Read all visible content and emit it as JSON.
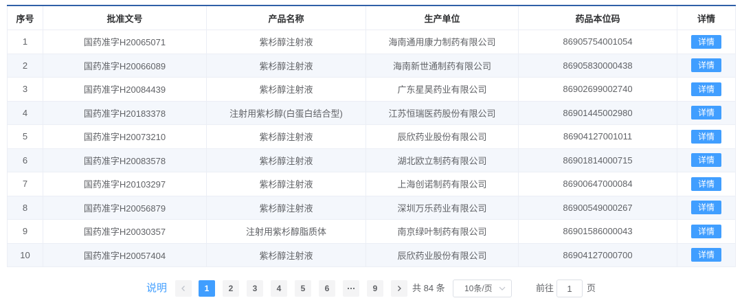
{
  "theme": {
    "accent": "#409eff",
    "header_border": "#2f5fa7",
    "stripe": "#f4f7fc",
    "text": "#606266",
    "heading": "#303133",
    "pager_bg": "#f4f4f5",
    "border": "#ebeef5",
    "muted": "#c0c4cc"
  },
  "table": {
    "columns": {
      "index": "序号",
      "approval_no": "批准文号",
      "product": "产品名称",
      "manufacturer": "生产单位",
      "code": "药品本位码",
      "action": "详情"
    },
    "rows": [
      {
        "index": "1",
        "approval_no": "国药准字H20065071",
        "product": "紫杉醇注射液",
        "manufacturer": "海南通用康力制药有限公司",
        "code": "86905754001054",
        "action": "详情"
      },
      {
        "index": "2",
        "approval_no": "国药准字H20066089",
        "product": "紫杉醇注射液",
        "manufacturer": "海南新世通制药有限公司",
        "code": "86905830000438",
        "action": "详情"
      },
      {
        "index": "3",
        "approval_no": "国药准字H20084439",
        "product": "紫杉醇注射液",
        "manufacturer": "广东星昊药业有限公司",
        "code": "86902699002740",
        "action": "详情"
      },
      {
        "index": "4",
        "approval_no": "国药准字H20183378",
        "product": "注射用紫杉醇(白蛋白结合型)",
        "manufacturer": "江苏恒瑞医药股份有限公司",
        "code": "86901445002980",
        "action": "详情"
      },
      {
        "index": "5",
        "approval_no": "国药准字H20073210",
        "product": "紫杉醇注射液",
        "manufacturer": "辰欣药业股份有限公司",
        "code": "86904127001011",
        "action": "详情"
      },
      {
        "index": "6",
        "approval_no": "国药准字H20083578",
        "product": "紫杉醇注射液",
        "manufacturer": "湖北欧立制药有限公司",
        "code": "86901814000715",
        "action": "详情"
      },
      {
        "index": "7",
        "approval_no": "国药准字H20103297",
        "product": "紫杉醇注射液",
        "manufacturer": "上海创诺制药有限公司",
        "code": "86900647000084",
        "action": "详情"
      },
      {
        "index": "8",
        "approval_no": "国药准字H20056879",
        "product": "紫杉醇注射液",
        "manufacturer": "深圳万乐药业有限公司",
        "code": "86900549000267",
        "action": "详情"
      },
      {
        "index": "9",
        "approval_no": "国药准字H20030357",
        "product": "注射用紫杉醇脂质体",
        "manufacturer": "南京绿叶制药有限公司",
        "code": "86901586000043",
        "action": "详情"
      },
      {
        "index": "10",
        "approval_no": "国药准字H20057404",
        "product": "紫杉醇注射液",
        "manufacturer": "辰欣药业股份有限公司",
        "code": "86904127000700",
        "action": "详情"
      }
    ]
  },
  "pagination": {
    "help_link": "说明",
    "prev_icon": "chevron-left-icon",
    "next_icon": "chevron-right-icon",
    "more_icon": "more-icon",
    "pages": [
      {
        "label": "1",
        "active": true
      },
      {
        "label": "2",
        "active": false
      },
      {
        "label": "3",
        "active": false
      },
      {
        "label": "4",
        "active": false
      },
      {
        "label": "5",
        "active": false
      },
      {
        "label": "6",
        "active": false
      }
    ],
    "last_page": "9",
    "total_text": "共 84 条",
    "page_size": "10条/页",
    "page_size_icon": "chevron-down-icon",
    "goto_label": "前往",
    "goto_value": "1",
    "goto_suffix": "页"
  }
}
